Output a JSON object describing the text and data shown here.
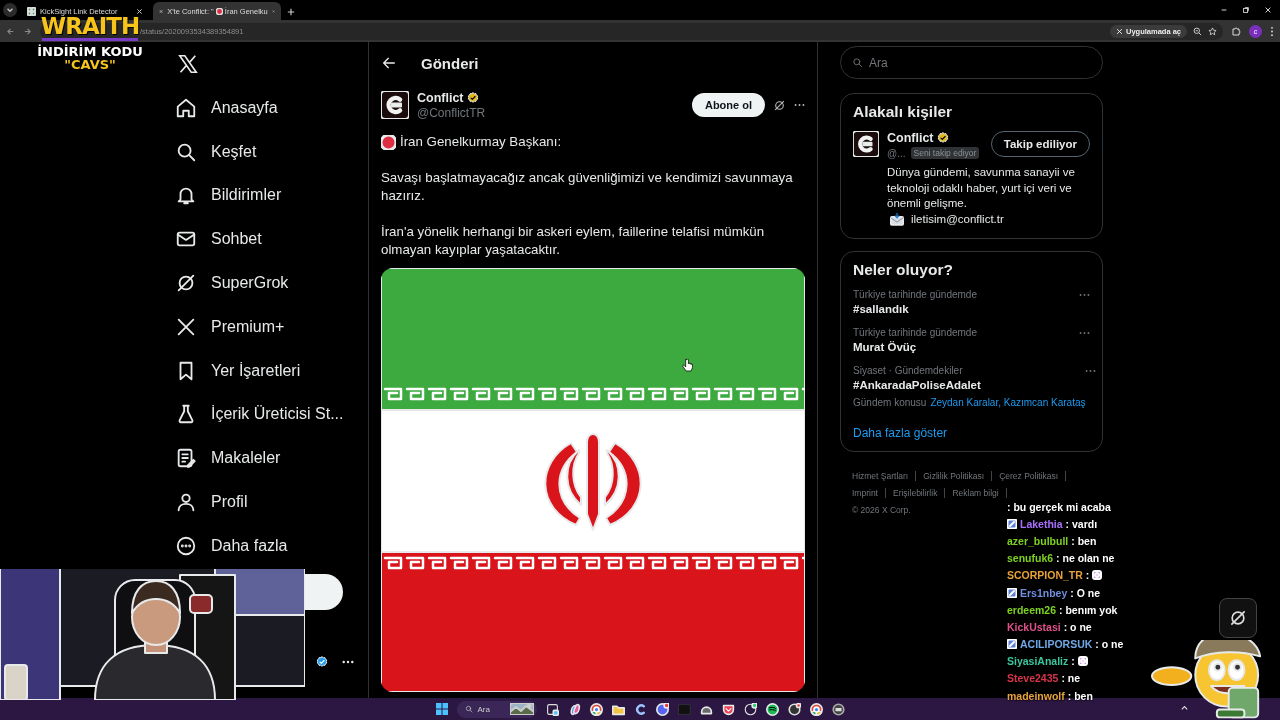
{
  "browser": {
    "tabs": [
      {
        "title": "KickSight Link Detector",
        "kind": "plain",
        "selected": false
      },
      {
        "title": "X'te Conflict: \"",
        "title_rest": "İran Genelku",
        "kind": "dot",
        "selected": true
      }
    ],
    "url": "/status/2020093534389354891",
    "open_in_app": "Uygulamada aç",
    "profile_initial": "c"
  },
  "sponsor_overlay": {
    "brand": "WRAITH",
    "line": "İNDİRİM KODU",
    "code": "\"CAVS\""
  },
  "nav": {
    "items": [
      {
        "label": "Anasayfa",
        "kind": "home"
      },
      {
        "label": "Keşfet",
        "kind": "explore"
      },
      {
        "label": "Bildirimler",
        "kind": "notifications"
      },
      {
        "label": "Sohbet",
        "kind": "messages"
      },
      {
        "label": "SuperGrok",
        "kind": "grok"
      },
      {
        "label": "Premium+",
        "kind": "premium"
      },
      {
        "label": "Yer İşaretleri",
        "kind": "bookmarks"
      },
      {
        "label": "İçerik Üreticisi St...",
        "kind": "creator"
      },
      {
        "label": "Makaleler",
        "kind": "articles"
      },
      {
        "label": "Profil",
        "kind": "profile"
      },
      {
        "label": "Daha fazla",
        "kind": "more"
      }
    ]
  },
  "post": {
    "header_title": "Gönderi",
    "author": {
      "name": "Conflict",
      "handle": "@ConflictTR",
      "verified": true
    },
    "subscribe_label": "Abone ol",
    "paragraphs": [
      {
        "kind": "dot",
        "text": "İran Genelkurmay Başkanı:"
      },
      {
        "kind": "plain",
        "text": "Savaşı başlatmayacağız ancak güvenliğimizi ve kendimizi savunmaya hazırız."
      },
      {
        "kind": "plain",
        "text": "İran'a yönelik herhangi bir askeri eylem, faillerine telafisi mümkün olmayan kayıplar yaşatacaktır."
      }
    ]
  },
  "right_rail": {
    "search_placeholder": "Ara",
    "people": {
      "title": "Alakalı kişiler",
      "person": {
        "name": "Conflict",
        "verified": true,
        "handle": "@...",
        "follows_you": "Seni takip ediyor",
        "button": "Takip ediliyor",
        "bio": "Dünya gündemi, savunma sanayii ve teknoloji odaklı haber, yurt içi veri ve önemli gelişme.",
        "email": "iletisim@conflict.tr"
      }
    },
    "trends": {
      "title": "Neler oluyor?",
      "items": [
        {
          "context": "Türkiye tarihinde gündemde",
          "topic": "#sallandık"
        },
        {
          "context": "Türkiye tarihinde gündemde",
          "topic": "Murat Övüç"
        },
        {
          "context": "Siyaset · Gündemdekiler",
          "topic": "#AnkaradaPoliseAdalet",
          "related_label": "Gündem konusu",
          "related": "Zeydan Karalar, Kazımcan Karataş"
        }
      ],
      "show_more": "Daha fazla göster"
    },
    "footer": {
      "links": [
        "Hizmet Şartları",
        "Gizlilik Politikası",
        "Çerez Politikası",
        "Imprint",
        "Erişilebilirlik",
        "Reklam bilgi"
      ],
      "copyright": "© 2026 X Corp."
    }
  },
  "chat": {
    "messages": [
      {
        "kind": "text",
        "message": ": bu gerçek mi acaba"
      },
      {
        "kind": "text",
        "user": "Lakethia",
        "color": "#a970ff",
        "badge": true,
        "message": ": vardı"
      },
      {
        "kind": "text",
        "user": "azer_bulbull",
        "color": "#7ed321",
        "badge": false,
        "message": ": ben"
      },
      {
        "kind": "text",
        "user": "senufuk6",
        "color": "#7ed321",
        "badge": false,
        "message": ": ne olan ne"
      },
      {
        "kind": "emote",
        "user": "SCORPION_TR",
        "color": "#e8a23a",
        "badge": false,
        "message": ":"
      },
      {
        "kind": "text",
        "user": "Ers1nbey",
        "color": "#6f8fe0",
        "badge": true,
        "message": ": O ne"
      },
      {
        "kind": "text",
        "user": "erdeem26",
        "color": "#7ed321",
        "badge": false,
        "message": ": benım yok"
      },
      {
        "kind": "text",
        "user": "KickUstasi",
        "color": "#e0508a",
        "badge": false,
        "message": ": o ne"
      },
      {
        "kind": "text",
        "user": "ACILIPORSUK",
        "color": "#6fa8e6",
        "badge": true,
        "message": ": o ne"
      },
      {
        "kind": "emote",
        "user": "SiyasiAnaliz",
        "color": "#3cc79e",
        "badge": false,
        "message": ":"
      },
      {
        "kind": "text",
        "user": "Steve2435",
        "color": "#d8344a",
        "badge": false,
        "message": ": ne"
      },
      {
        "kind": "text",
        "user": "madeinwolf",
        "color": "#e8a23a",
        "badge": false,
        "message": ": ben"
      }
    ]
  },
  "taskbar": {
    "search_placeholder": "Ara"
  }
}
